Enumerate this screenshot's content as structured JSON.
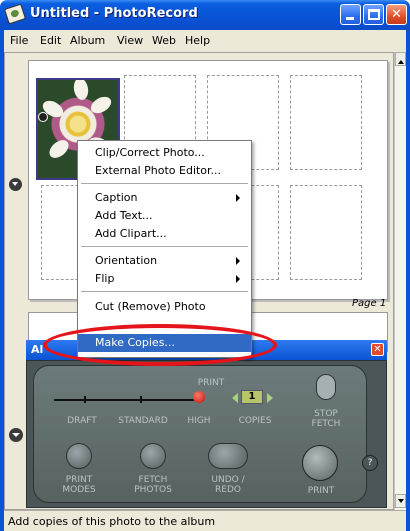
{
  "window": {
    "title": "Untitled - PhotoRecord"
  },
  "menubar": [
    {
      "label": "File"
    },
    {
      "label": "Edit"
    },
    {
      "label": "Album"
    },
    {
      "label": "View"
    },
    {
      "label": "Web"
    },
    {
      "label": "Help"
    }
  ],
  "page": {
    "label": "Page 1"
  },
  "context_menu": {
    "items": [
      {
        "label": "Clip/Correct Photo..."
      },
      {
        "label": "External Photo Editor..."
      },
      {
        "label": "Caption",
        "submenu": true
      },
      {
        "label": "Add Text..."
      },
      {
        "label": "Add Clipart..."
      },
      {
        "label": "Orientation",
        "submenu": true
      },
      {
        "label": "Flip",
        "submenu": true
      },
      {
        "label": "Cut (Remove) Photo"
      },
      {
        "label": "Make Copies...",
        "highlighted": true
      }
    ]
  },
  "album_panel": {
    "title": "Al",
    "print_label": "PRINT",
    "quality": [
      "DRAFT",
      "STANDARD",
      "HIGH"
    ],
    "copies_label": "COPIES",
    "copies_value": "1",
    "stop_fetch": "STOP FETCH",
    "print_modes": "PRINT MODES",
    "fetch_photos": "FETCH PHOTOS",
    "undo_redo": "UNDO / REDO",
    "print_button": "PRINT",
    "help": "?",
    "selected_quality": "HIGH"
  },
  "statusbar": {
    "text": "Add copies of this photo to the album"
  },
  "colors": {
    "titlebar": "#0a53d6",
    "highlight": "#316ac5",
    "ring": "#e5141a",
    "panel": "#4a5658"
  }
}
